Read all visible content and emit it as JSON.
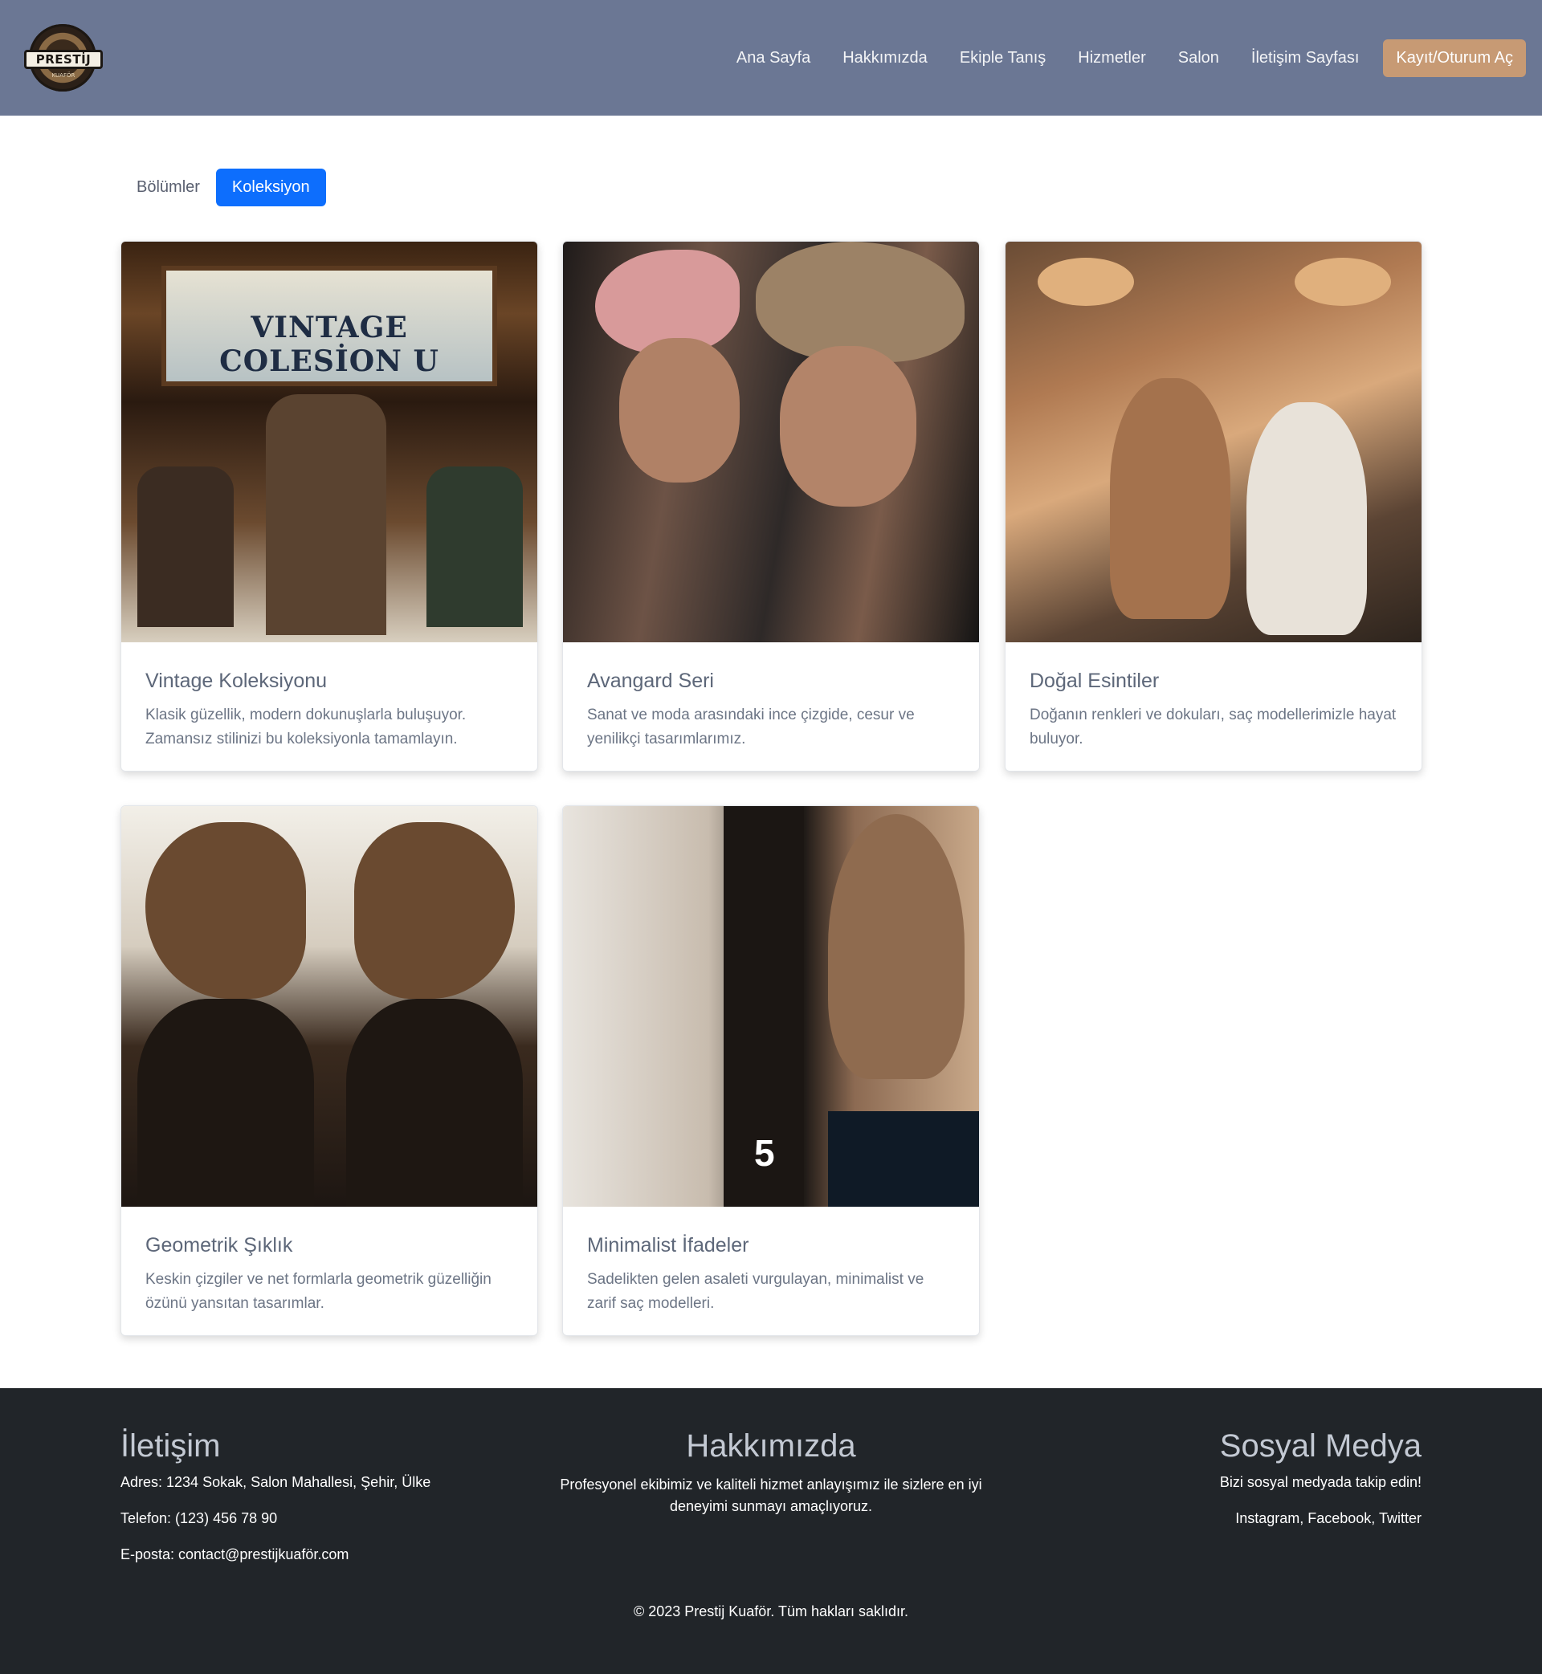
{
  "brand": {
    "logo_text": "PRESTİJ",
    "logo_sub": "KUAFÖR"
  },
  "nav": {
    "items": [
      "Ana Sayfa",
      "Hakkımızda",
      "Ekiple Tanış",
      "Hizmetler",
      "Salon",
      "İletişim Sayfası"
    ],
    "cta": "Kayıt/Oturum Aç"
  },
  "tabs": [
    {
      "label": "Bölümler",
      "active": false
    },
    {
      "label": "Koleksiyon",
      "active": true
    }
  ],
  "cards": [
    {
      "title": "Vintage Koleksiyonu",
      "desc": "Klasik güzellik, modern dokunuşlarla buluşuyor. Zamansız stilinizi bu koleksiyonla tamamlayın.",
      "img_sign": "VINTAGE COLESİON U"
    },
    {
      "title": "Avangard Seri",
      "desc": "Sanat ve moda arasındaki ince çizgide, cesur ve yenilikçi tasarımlarımız."
    },
    {
      "title": "Doğal Esintiler",
      "desc": "Doğanın renkleri ve dokuları, saç modellerimizle hayat buluyor."
    },
    {
      "title": "Geometrik Şıklık",
      "desc": "Keskin çizgiler ve net formlarla geometrik güzelliğin özünü yansıtan tasarımlar."
    },
    {
      "title": "Minimalist İfadeler",
      "desc": "Sadelikten gelen asaleti vurgulayan, minimalist ve zarif saç modelleri.",
      "img_number": "5"
    }
  ],
  "footer": {
    "contact": {
      "heading": "İletişim",
      "address": "Adres: 1234 Sokak, Salon Mahallesi, Şehir, Ülke",
      "phone": "Telefon: (123) 456 78 90",
      "email": "E-posta: contact@prestijkuaför.com"
    },
    "about": {
      "heading": "Hakkımızda",
      "text": "Profesyonel ekibimiz ve kaliteli hizmet anlayışımız ile sizlere en iyi deneyimi sunmayı amaçlıyoruz."
    },
    "social": {
      "heading": "Sosyal Medya",
      "text": "Bizi sosyal medyada takip edin!",
      "links": "Instagram, Facebook, Twitter"
    },
    "copyright": "© 2023 Prestij Kuaför. Tüm hakları saklıdır."
  },
  "colors": {
    "navbar": "#6b7794",
    "cta": "#c79a74",
    "active_tab": "#0d6efd",
    "footer": "#212529"
  }
}
